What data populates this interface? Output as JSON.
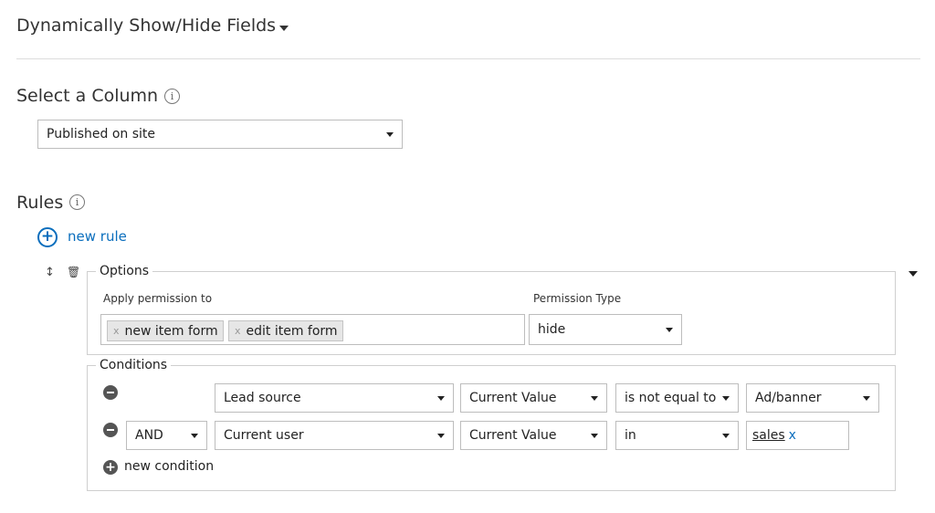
{
  "header": {
    "title": "Dynamically Show/Hide Fields"
  },
  "column_section": {
    "title": "Select a Column",
    "selected": "Published on site"
  },
  "rules_section": {
    "title": "Rules",
    "new_rule_label": "new rule"
  },
  "options": {
    "legend": "Options",
    "apply_label": "Apply permission to",
    "tags": [
      "new item form",
      "edit item form"
    ],
    "permission_type_label": "Permission Type",
    "permission_type_value": "hide"
  },
  "conditions": {
    "legend": "Conditions",
    "rows": [
      {
        "connector": "",
        "field": "Lead source",
        "value_type": "Current Value",
        "operator": "is not equal to",
        "value": "Ad/banner"
      },
      {
        "connector": "AND",
        "field": "Current user",
        "value_type": "Current Value",
        "operator": "in",
        "value": "sales"
      }
    ],
    "new_condition_label": "new condition"
  },
  "colors": {
    "accent": "#0a6ebd",
    "border": "#bdbdbd"
  }
}
